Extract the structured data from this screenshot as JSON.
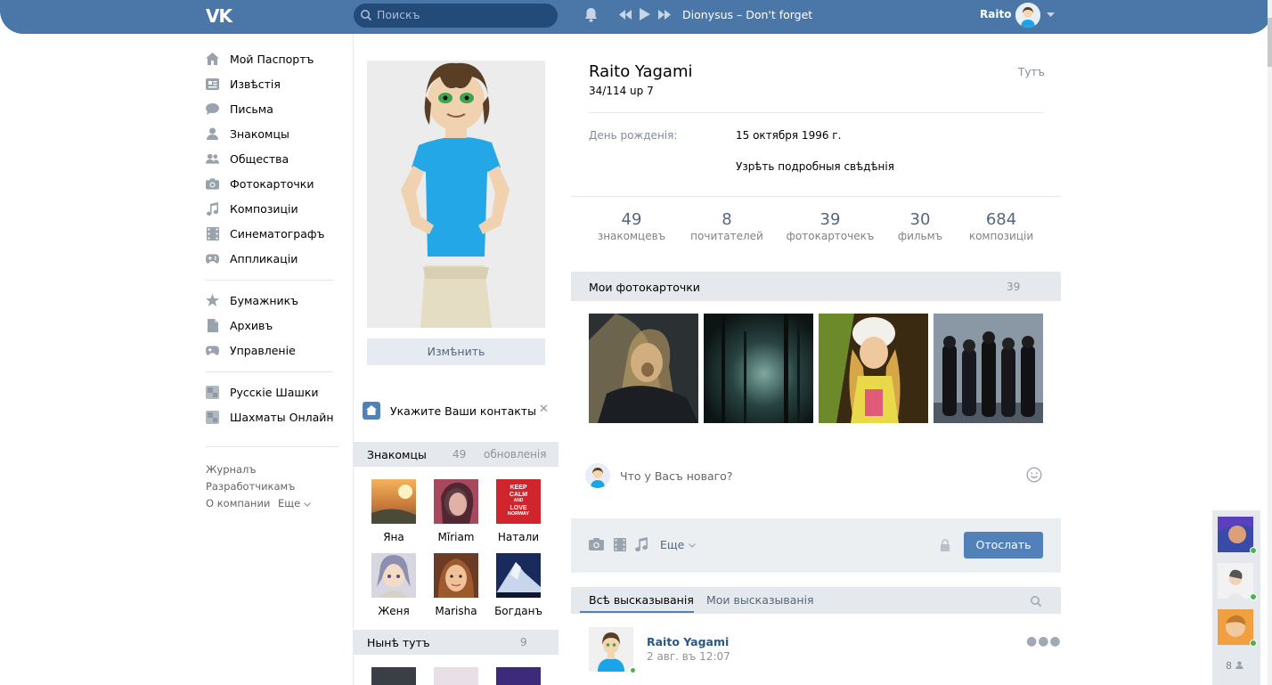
{
  "header": {
    "logo": "VK",
    "search_placeholder": "Поискъ",
    "track": "Dionysus – Don't forget",
    "user": "Raito"
  },
  "nav": {
    "main": [
      "Мой Паспортъ",
      "Извѣстія",
      "Письма",
      "Знакомцы",
      "Общества",
      "Фотокарточки",
      "Композиціи",
      "Синематографъ",
      "Аппликаціи"
    ],
    "extra": [
      "Бумажникъ",
      "Архивъ",
      "Управленіе"
    ],
    "games": [
      "Русскіе Шашки",
      "Шахматы Онлайн"
    ],
    "footer": {
      "journal": "Журналъ",
      "devs": "Разработчикамъ",
      "about": "О компании",
      "more": "Еще"
    }
  },
  "profile": {
    "edit_label": "Измѣнить",
    "contacts_prompt": "Укажите Ваши контакты",
    "name": "Raito Yagami",
    "status": "34/114 up 7",
    "here": "Тутъ",
    "birthday_label": "День рожденія:",
    "birthday_value": "15 октября 1996 г.",
    "more_info": "Узрѣть подробныя свѣдѣнія"
  },
  "counters": [
    {
      "n": "49",
      "l": "знакомцевъ"
    },
    {
      "n": "8",
      "l": "почитателей"
    },
    {
      "n": "39",
      "l": "фотокарточекъ"
    },
    {
      "n": "30",
      "l": "фильмъ"
    },
    {
      "n": "684",
      "l": "композиціи"
    }
  ],
  "friends": {
    "title": "Знакомцы",
    "count": "49",
    "updates": "обновленія",
    "items": [
      "Яна",
      "Mĭriam",
      "Натали",
      "Женя",
      "Marisha",
      "Богданъ"
    ],
    "keep_calm": [
      "KEEP",
      "CALM",
      "AND",
      "LOVE",
      "NORWAY"
    ]
  },
  "online": {
    "title": "Нынѣ тутъ",
    "count": "9"
  },
  "photos": {
    "title": "Мои фотокарточки",
    "count": "39"
  },
  "post": {
    "placeholder": "Что у Васъ новаго?",
    "more": "Еще",
    "send": "Отослать"
  },
  "wall": {
    "tab_all": "Всѣ высказыванія",
    "tab_mine": "Мои высказыванія",
    "author": "Raito Yagami",
    "date": "2 авг. въ 12:07"
  },
  "chat": {
    "count": "8"
  },
  "colors": {
    "header": "#4a76a8",
    "accent": "#5181b8",
    "link": "#2a5885",
    "online": "#4bb34b"
  }
}
